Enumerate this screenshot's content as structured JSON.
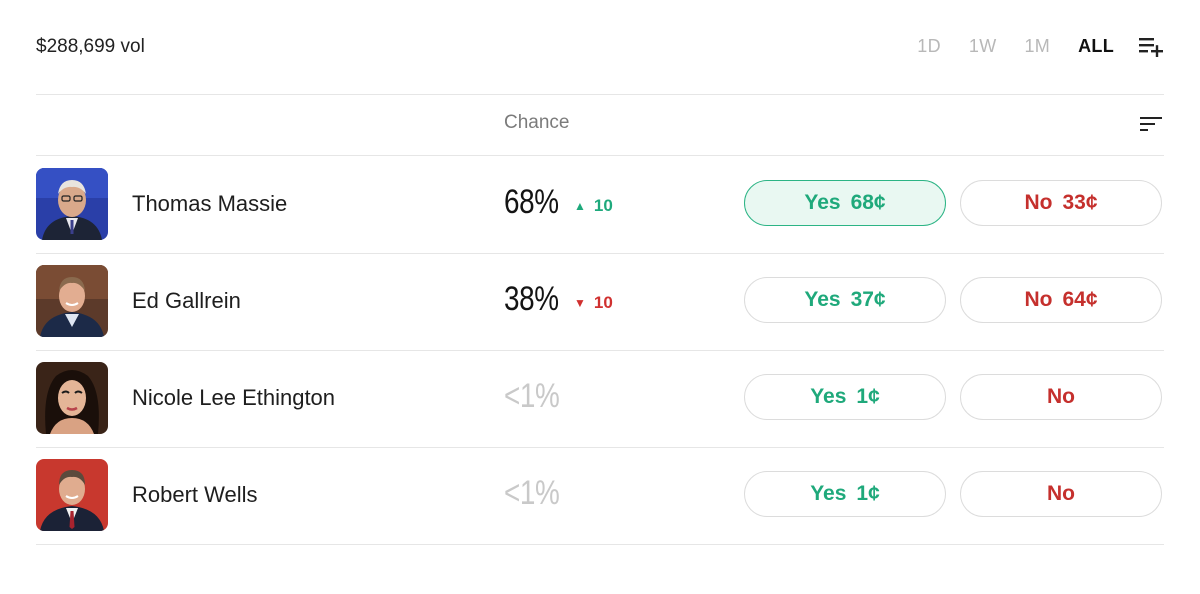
{
  "header": {
    "volume": "$288,699 vol",
    "ranges": [
      "1D",
      "1W",
      "1M",
      "ALL"
    ],
    "active_range": "ALL"
  },
  "columns": {
    "chance": "Chance"
  },
  "candidates": [
    {
      "name": "Thomas Massie",
      "chance": "68%",
      "delta": "10",
      "delta_dir": "up",
      "yes_label": "Yes",
      "yes_price": "68¢",
      "no_label": "No",
      "no_price": "33¢"
    },
    {
      "name": "Ed Gallrein",
      "chance": "38%",
      "delta": "10",
      "delta_dir": "down",
      "yes_label": "Yes",
      "yes_price": "37¢",
      "no_label": "No",
      "no_price": "64¢"
    },
    {
      "name": "Nicole Lee Ethington",
      "chance": "<1%",
      "yes_label": "Yes",
      "yes_price": "1¢",
      "no_label": "No",
      "no_price": ""
    },
    {
      "name": "Robert Wells",
      "chance": "<1%",
      "yes_label": "Yes",
      "yes_price": "1¢",
      "no_label": "No",
      "no_price": ""
    }
  ],
  "colors": {
    "yes": "#1fa97b",
    "no": "#c5302d",
    "up": "#1ea97c",
    "down": "#d0302f"
  },
  "icons": {
    "add_list": "playlist-add-icon",
    "sort": "sort-icon",
    "up": "triangle-up-icon",
    "down": "triangle-down-icon"
  }
}
